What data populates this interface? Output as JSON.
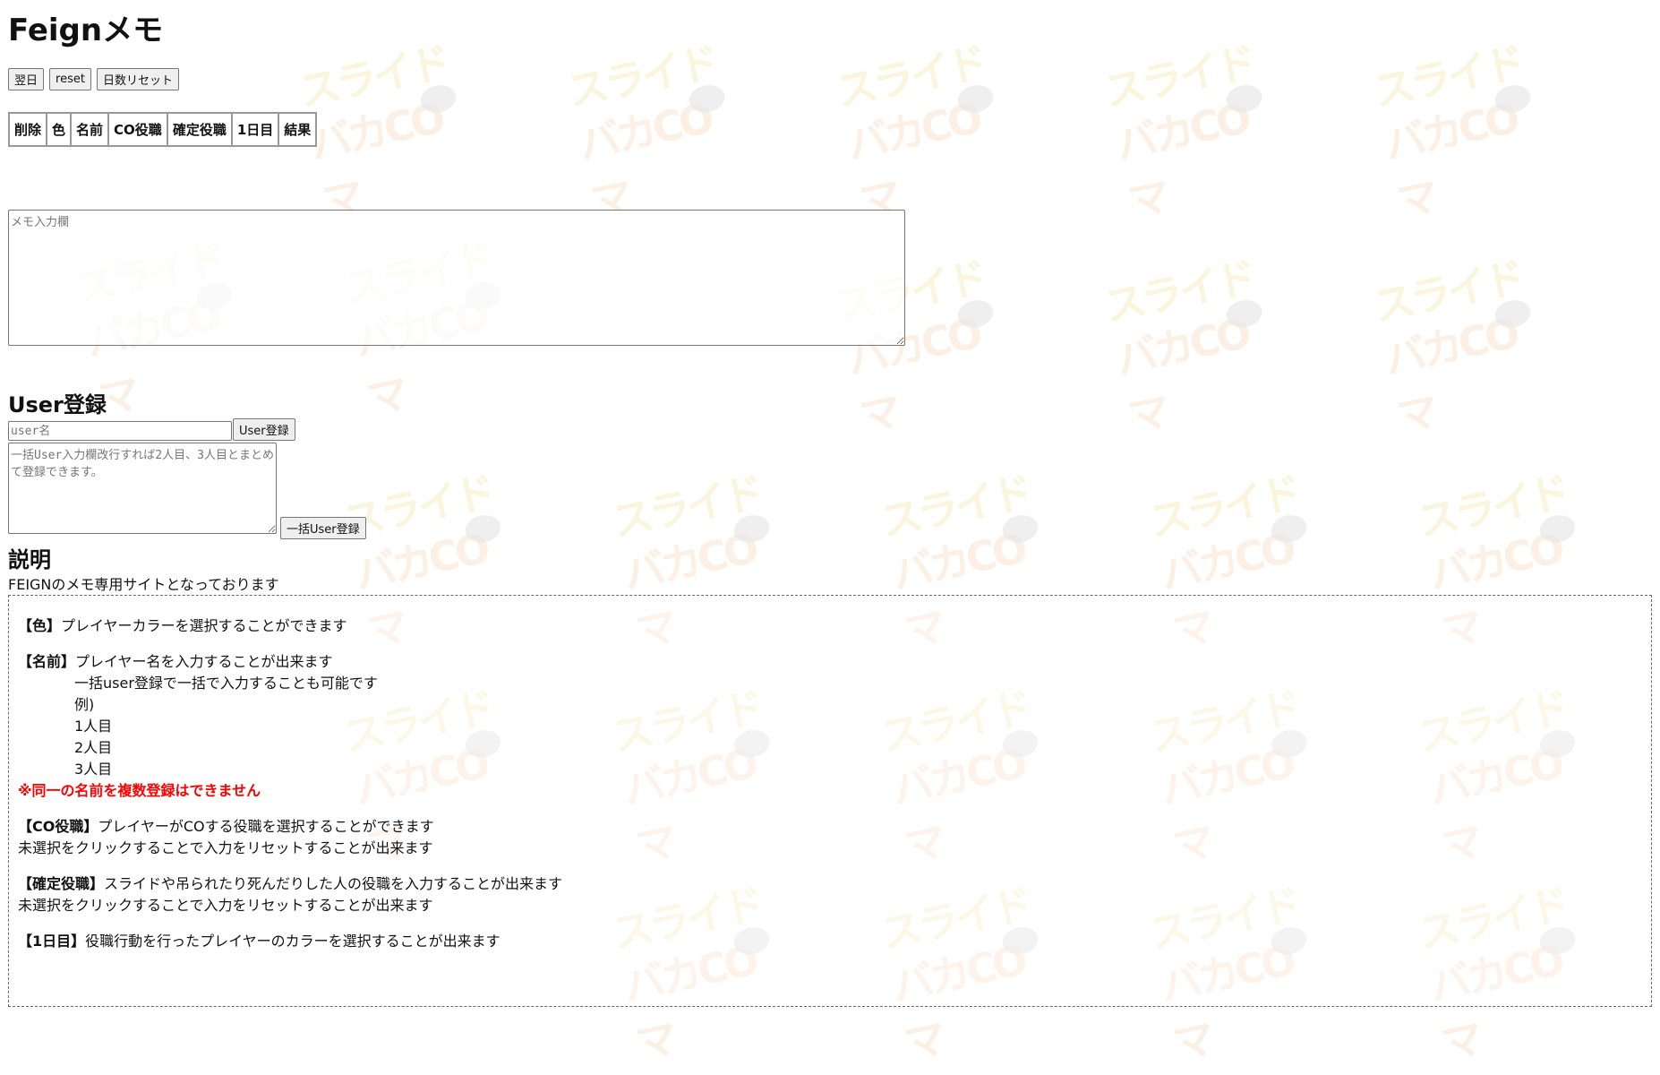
{
  "header": {
    "title": "Feignメモ"
  },
  "toolbar": {
    "next_day": "翌日",
    "reset": "reset",
    "day_reset": "日数リセット"
  },
  "table": {
    "headers": [
      "削除",
      "色",
      "名前",
      "CO役職",
      "確定役職",
      "1日目",
      "結果"
    ]
  },
  "memo": {
    "placeholder": "メモ入力欄"
  },
  "user": {
    "title": "User登録",
    "input_placeholder": "user名",
    "register_button": "User登録",
    "bulk_placeholder": "一括User入力欄改行すれば2人目、3人目とまとめて登録できます。",
    "bulk_button": "一括User登録"
  },
  "description": {
    "title": "説明",
    "subtitle": "FEIGNのメモ専用サイトとなっております",
    "color_label": "【色】",
    "color_text": "プレイヤーカラーを選択することができます",
    "name_label": "【名前】",
    "name_text": "プレイヤー名を入力することが出来ます",
    "name_lines": [
      "一括user登録で一括で入力することも可能です",
      "例)",
      "1人目",
      "2人目",
      "3人目"
    ],
    "warning": "※同一の名前を複数登録はできません",
    "co_label": "【CO役職】",
    "co_text": "プレイヤーがCOする役職を選択することができます",
    "co_reset": "未選択をクリックすることで入力をリセットすることが出来ます",
    "fixed_label": "【確定役職】",
    "fixed_text": "スライドや吊られたり死んだりした人の役職を入力することが出来ます",
    "fixed_reset": "未選択をクリックすることで入力をリセットすることが出来ます",
    "day1_label": "【1日目】",
    "day1_text": "役職行動を行ったプレイヤーのカラーを選択することが出来ます"
  }
}
